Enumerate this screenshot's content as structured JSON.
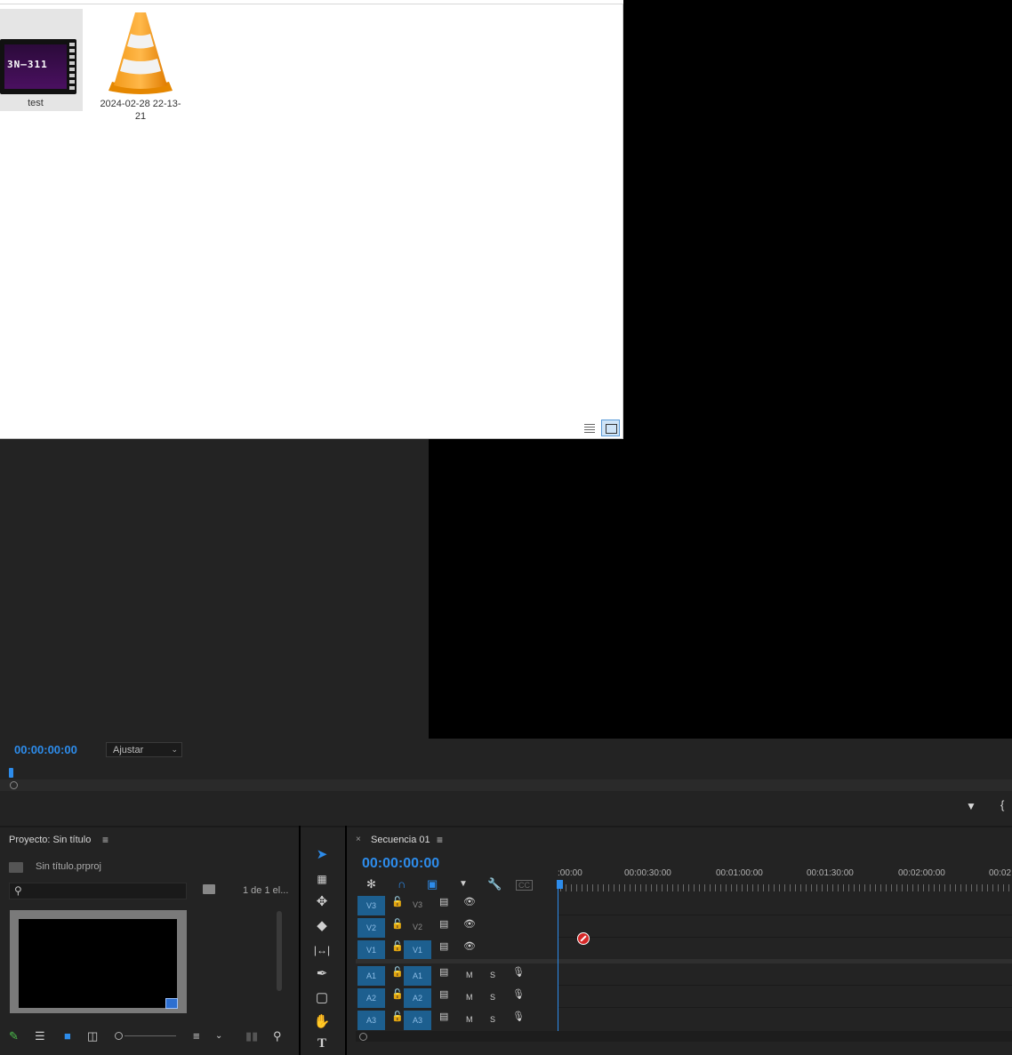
{
  "explorer": {
    "files": [
      {
        "name": "test",
        "thumb_text": "3N–311"
      },
      {
        "name": "2024-02-28 22-13-21"
      }
    ]
  },
  "program_monitor": {
    "timecode": "00:00:00:00",
    "fit_option": "Ajustar"
  },
  "project": {
    "title": "Proyecto: Sin título",
    "filename": "Sin título.prproj",
    "item_count": "1 de 1 el...",
    "search_placeholder": ""
  },
  "timeline": {
    "tab_label": "Secuencia 01",
    "timecode": "00:00:00:00",
    "ruler": [
      ":00:00",
      "00:00:30:00",
      "00:01:00:00",
      "00:01:30:00",
      "00:02:00:00",
      "00:02"
    ],
    "video_tracks": [
      {
        "target": "V3",
        "name": "V3"
      },
      {
        "target": "V2",
        "name": "V2"
      },
      {
        "target": "V1",
        "name": "V1"
      }
    ],
    "audio_tracks": [
      {
        "target": "A1",
        "name": "A1",
        "m": "M",
        "s": "S"
      },
      {
        "target": "A2",
        "name": "A2",
        "m": "M",
        "s": "S"
      },
      {
        "target": "A3",
        "name": "A3",
        "m": "M",
        "s": "S"
      }
    ]
  },
  "colors": {
    "accent": "#2d8ceb",
    "panel": "#232323",
    "track_target": "#1d5f8f"
  }
}
